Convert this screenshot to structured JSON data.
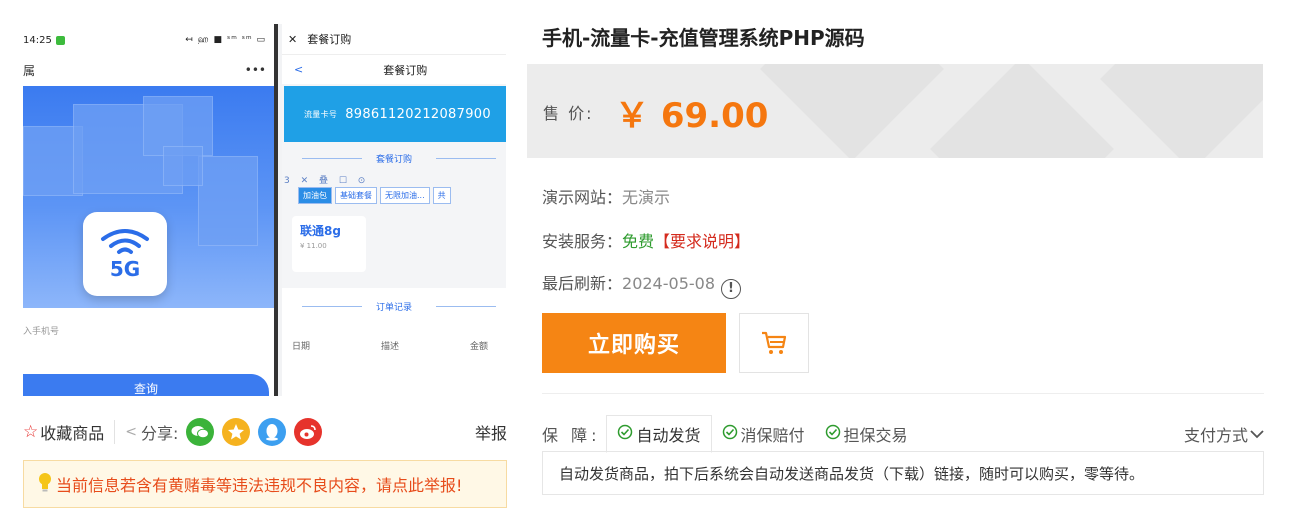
{
  "screenshot": {
    "left_phone": {
      "time": "14:25",
      "status_icons": "↤ ஹ ■ ˢᵐ ˢᵐ ▭",
      "nav_title": "属",
      "more": "•••",
      "badge": "5G",
      "input_placeholder": "入手机号",
      "query_button": "查询"
    },
    "right_phone": {
      "close": "✕",
      "top_title": "套餐订购",
      "back": "<",
      "page_title": "套餐订购",
      "card_label": "流量卡号",
      "card_number": "89861120212087900",
      "section_order": "套餐订购",
      "toolbar": "3 ✕ 叠 ☐ ⊙",
      "tabs": [
        "加油包",
        "基础套餐",
        "无限加油...",
        "共"
      ],
      "package_name": "联通8g",
      "package_price": "¥ 11.00",
      "section_records": "订单记录",
      "record_cols": [
        "日期",
        "描述",
        "金额"
      ]
    }
  },
  "actions": {
    "favorite": "收藏商品",
    "share": "分享:",
    "report": "举报"
  },
  "notice": "当前信息若含有黄赌毒等违法违规不良内容，请点此举报!",
  "product": {
    "title": "手机-流量卡-充值管理系统PHP源码",
    "price_label": "售  价:",
    "price": "￥ 69.00",
    "demo_label": "演示网站：",
    "demo_value": "无演示",
    "install_label": "安装服务：",
    "install_free": "免费",
    "install_req": "【要求说明】",
    "refresh_label": "最后刷新：",
    "refresh_value": "2024-05-08",
    "help_glyph": "!",
    "buy_now": "立即购买",
    "guarantee_label": "保  障:",
    "guarantees": [
      "自动发货",
      "消保赔付",
      "担保交易"
    ],
    "payment": "支付方式",
    "guarantee_desc": "自动发货商品，拍下后系统会自动发送商品发货（下载）链接，随时可以购买，零等待。"
  },
  "icons": {
    "favorite": "star-outline-icon",
    "share": "share-icon",
    "social": [
      "wechat-icon",
      "qzone-icon",
      "qq-icon",
      "weibo-icon"
    ],
    "notice": "lightbulb-icon",
    "help": "exclamation-circle-icon",
    "cart": "cart-icon",
    "check": "check-circle-icon",
    "chevron": "chevron-down-icon"
  },
  "colors": {
    "price": "#f5770f",
    "buy_button": "#f58514",
    "free": "#2e9b2e",
    "requirement": "#d42b1e",
    "notice_text": "#e74c1b",
    "wechat": "#3bb33a",
    "qzone": "#f5b21f",
    "qq": "#3c9ff0",
    "weibo": "#e6332c"
  }
}
